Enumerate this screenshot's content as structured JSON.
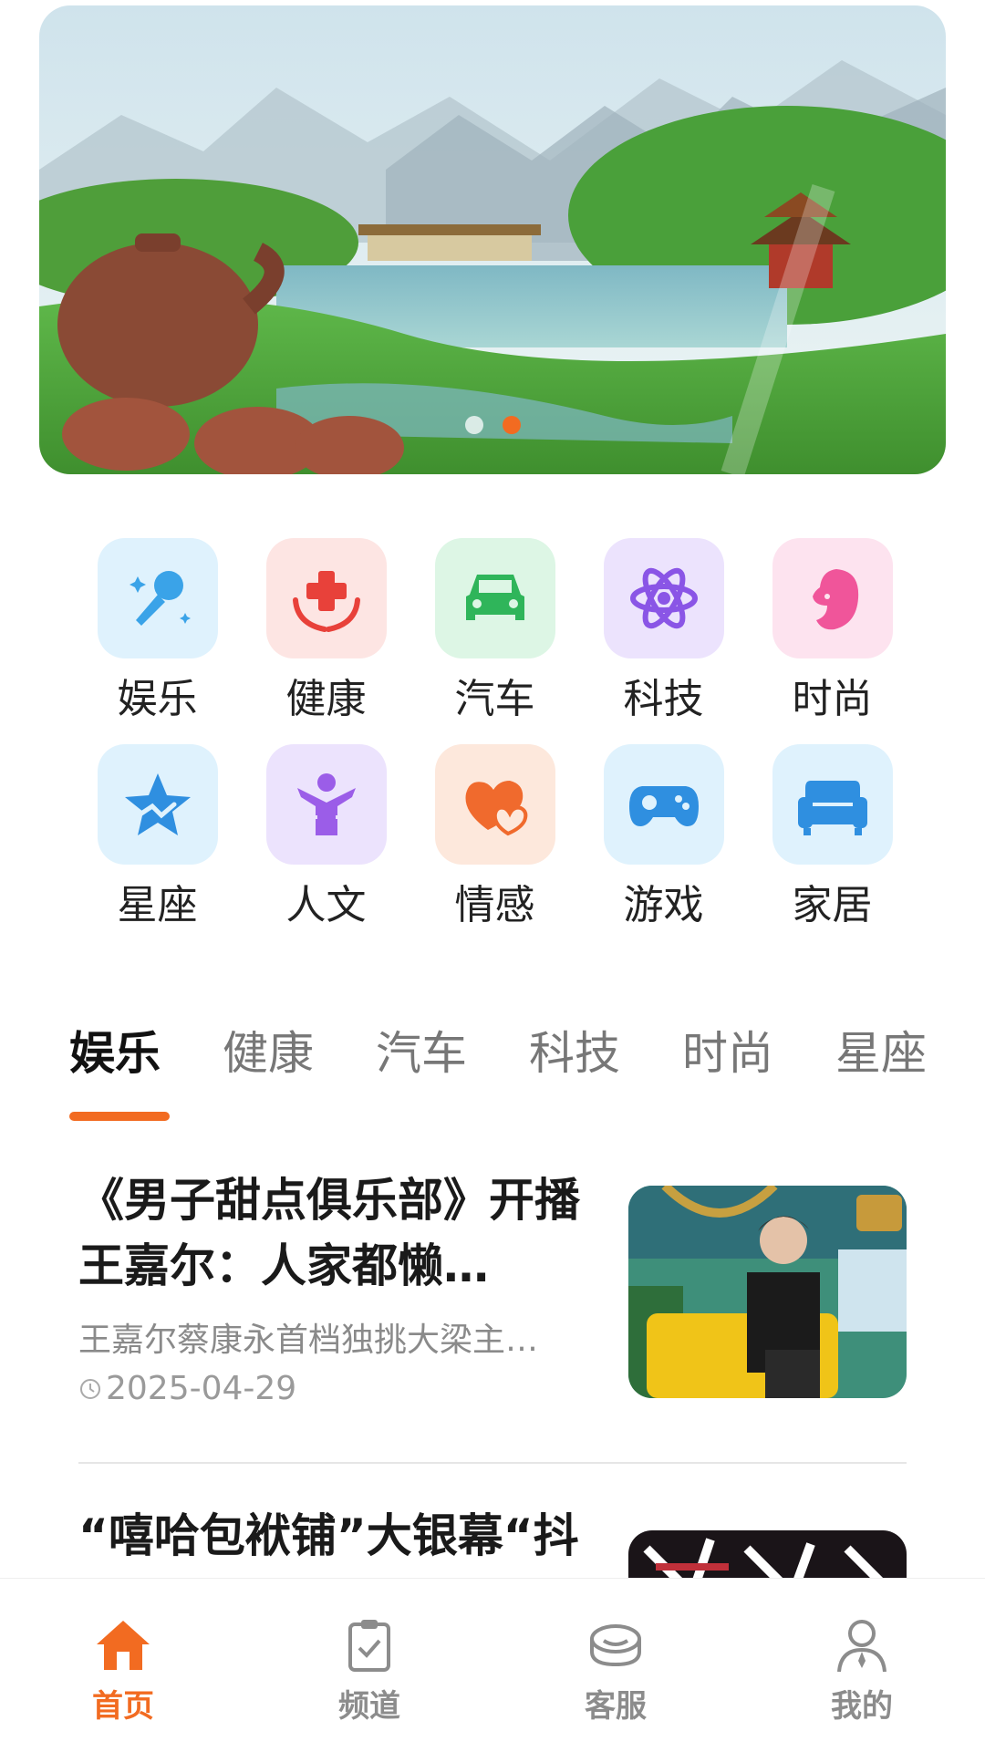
{
  "banner": {
    "slide_count": 2,
    "active_index": 1
  },
  "categories": [
    {
      "label": "娱乐",
      "icon": "microphone-icon",
      "color": "#3aa3e8",
      "bg": "#dff2fd"
    },
    {
      "label": "健康",
      "icon": "health-cross-hands-icon",
      "color": "#e8413a",
      "bg": "#fde5e3"
    },
    {
      "label": "汽车",
      "icon": "car-icon",
      "color": "#2fb55a",
      "bg": "#ddf6e5"
    },
    {
      "label": "科技",
      "icon": "atom-icon",
      "color": "#8a55e6",
      "bg": "#ece3fd"
    },
    {
      "label": "时尚",
      "icon": "woman-profile-icon",
      "color": "#f0559a",
      "bg": "#fde3ef"
    },
    {
      "label": "星座",
      "icon": "star-icon",
      "color": "#2f8fe0",
      "bg": "#dff2fd"
    },
    {
      "label": "人文",
      "icon": "person-arms-up-icon",
      "color": "#9b5de8",
      "bg": "#ece3fd"
    },
    {
      "label": "情感",
      "icon": "hearts-icon",
      "color": "#f06a2d",
      "bg": "#fde8dc"
    },
    {
      "label": "游戏",
      "icon": "gamepad-icon",
      "color": "#2f8fe0",
      "bg": "#dff2fd"
    },
    {
      "label": "家居",
      "icon": "sofa-icon",
      "color": "#2f8fe0",
      "bg": "#dff2fd"
    }
  ],
  "tabs": [
    {
      "label": "娱乐",
      "active": true
    },
    {
      "label": "健康",
      "active": false
    },
    {
      "label": "汽车",
      "active": false
    },
    {
      "label": "科技",
      "active": false
    },
    {
      "label": "时尚",
      "active": false
    },
    {
      "label": "星座",
      "active": false
    }
  ],
  "articles": [
    {
      "title": "《男子甜点俱乐部》开播 王嘉尔：人家都懒…",
      "summary": "王嘉尔蔡康永首档独挑大梁主…",
      "date": "2025-04-29"
    },
    {
      "title": "“嘻哈包袱铺”大银幕“抖",
      "summary": "",
      "date": ""
    }
  ],
  "bottom_nav": [
    {
      "label": "首页",
      "icon": "home-icon",
      "active": true
    },
    {
      "label": "频道",
      "icon": "clipboard-check-icon",
      "active": false
    },
    {
      "label": "客服",
      "icon": "customer-service-icon",
      "active": false
    },
    {
      "label": "我的",
      "icon": "user-icon",
      "active": false
    }
  ],
  "colors": {
    "accent": "#f26b21",
    "inactive_text": "#8c8c8c"
  }
}
